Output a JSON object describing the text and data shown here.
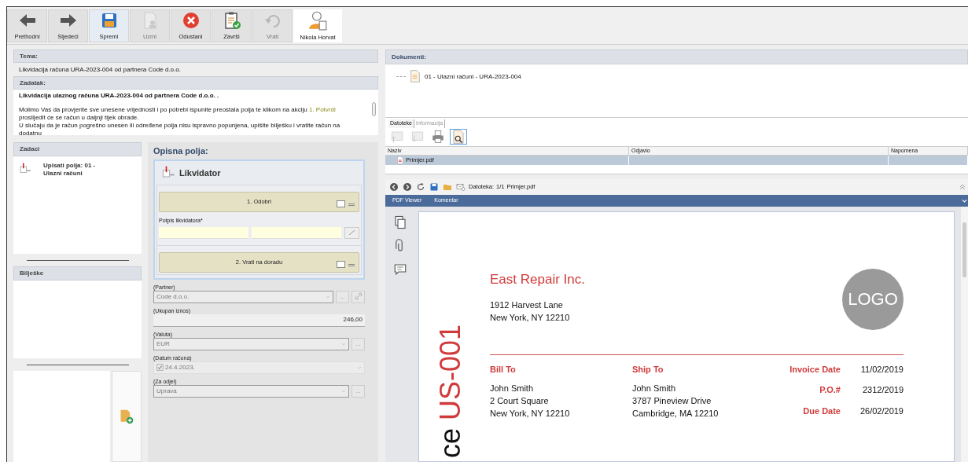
{
  "toolbar": {
    "buttons": [
      {
        "label": "Prethodni",
        "kind": "back",
        "disabled": false,
        "highlighted": false
      },
      {
        "label": "Sljedeći",
        "kind": "forward",
        "disabled": false,
        "highlighted": false
      },
      {
        "label": "Spremi",
        "kind": "save",
        "disabled": false,
        "highlighted": true
      },
      {
        "label": "Uzmi",
        "kind": "take",
        "disabled": true,
        "highlighted": false
      },
      {
        "label": "Odustani",
        "kind": "cancel",
        "disabled": false,
        "highlighted": false
      },
      {
        "label": "Završi",
        "kind": "finish",
        "disabled": false,
        "highlighted": false
      },
      {
        "label": "Vrati",
        "kind": "undo",
        "disabled": true,
        "highlighted": false
      }
    ],
    "user": {
      "name": "Nikola Horvat"
    }
  },
  "tema": {
    "label": "Tema:",
    "value": "Likvidacija računa URA-2023-004 od partnera Code d.o.o."
  },
  "zadatak": {
    "label": "Zadatak:",
    "title": "Likvidacija ulaznog računa  URA-2023-004  od partnera  Code d.o.o. .",
    "paragraphs": [
      [
        {
          "text": "Molimo Vas da provjerite sve unesene vrijednosti i po potrebi ispunite preostala polja te klikom na akciju "
        },
        {
          "text": "1. Potvrdi",
          "kind": "action"
        },
        {
          "text": " proslijedit će se račun u daljnji tijek obrade."
        }
      ],
      [
        {
          "text": "U slučaju da je račun pogrešno unesen ili određene polja nisu ispravno popunjena, upišite bilješku i vratite račun na dodatnu"
        }
      ]
    ]
  },
  "zadaci": {
    "label": "Zadaci",
    "items": [
      {
        "label": "Upisati polja: 01 - Ulazni računi"
      }
    ]
  },
  "biljeske": {
    "label": "Bilješke"
  },
  "opisna_polja": {
    "label": "Opisna polja:",
    "group": "Likvidator",
    "actions": [
      {
        "label": "1. Odobri",
        "checked": false
      },
      {
        "label": "2. Vrati na doradu",
        "checked": false
      }
    ],
    "signature": {
      "label": "Potpis likvidatora*"
    },
    "fields": [
      {
        "label": "(Partner)",
        "value": "Code d.o.o.",
        "kind": "combo",
        "button": "...",
        "link": true
      },
      {
        "label": "(Ukupan iznos)",
        "value": "246,00",
        "kind": "number"
      },
      {
        "label": "(Valuta)",
        "value": "EUR",
        "kind": "combo",
        "button": "..."
      },
      {
        "label": "(Datum računa)",
        "value": "24.4.2023.",
        "kind": "date",
        "checked": true
      },
      {
        "label": "(Za odjel)",
        "value": "Uprava",
        "kind": "combo",
        "button": "..."
      }
    ]
  },
  "dokumenti": {
    "label": "Dokumenti:",
    "tree": [
      {
        "label": "01 - Ulazni računi - URA-2023-004"
      }
    ]
  },
  "files": {
    "tabs": [
      {
        "label": "Datoteke",
        "selected": true
      },
      {
        "label": "Informacija",
        "selected": false
      }
    ],
    "columns": [
      "Naziv",
      "Odjavio",
      "Napomena"
    ],
    "rows": [
      {
        "name": "Primjer.pdf",
        "selected": true
      }
    ]
  },
  "viewer": {
    "file_label": "Datoteka:",
    "page": "1/1",
    "file_name": "Primjer.pdf",
    "tabs": [
      "PDF Viewer",
      "Komentar"
    ],
    "invoice": {
      "company": "East Repair Inc.",
      "address": [
        "1912 Harvest Lane",
        "New York, NY 12210"
      ],
      "title_visible": "ce",
      "number": "US-001",
      "logo": "LOGO",
      "bill_to": {
        "heading": "Bill To",
        "lines": [
          "John Smith",
          "2 Court Square",
          "New York, NY 12210"
        ]
      },
      "ship_to": {
        "heading": "Ship To",
        "lines": [
          "John Smith",
          "3787 Pineview Drive",
          "Cambridge, MA 12210"
        ]
      },
      "meta": [
        {
          "label": "Invoice Date",
          "value": "11/02/2019"
        },
        {
          "label": "P.O.#",
          "value": "2312/2019"
        },
        {
          "label": "Due Date",
          "value": "26/02/2019"
        }
      ]
    }
  }
}
